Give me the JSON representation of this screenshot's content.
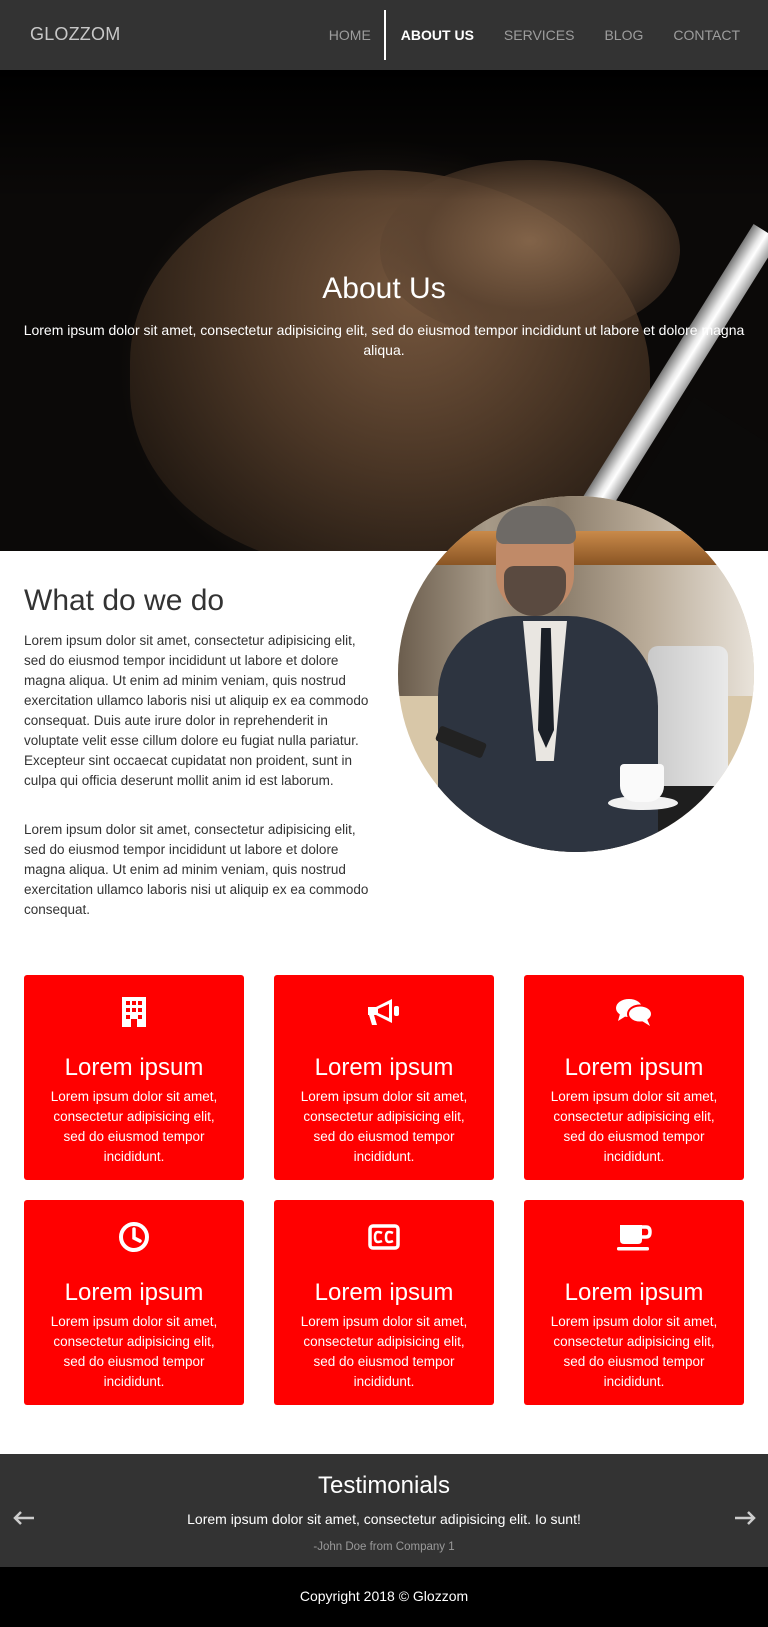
{
  "nav": {
    "brand": "GLOZZOM",
    "links": [
      {
        "label": "HOME",
        "active": false
      },
      {
        "label": "ABOUT US",
        "active": true
      },
      {
        "label": "SERVICES",
        "active": false
      },
      {
        "label": "BLOG",
        "active": false
      },
      {
        "label": "CONTACT",
        "active": false
      }
    ]
  },
  "hero": {
    "title": "About Us",
    "text": "Lorem ipsum dolor sit amet, consectetur adipisicing elit, sed do eiusmod tempor incididunt ut labore et dolore magna aliqua."
  },
  "about": {
    "title": "What do we do",
    "paragraph1": "Lorem ipsum dolor sit amet, consectetur adipisicing elit, sed do eiusmod tempor incididunt ut labore et dolore magna aliqua. Ut enim ad minim veniam, quis nostrud exercitation ullamco laboris nisi ut aliquip ex ea commodo consequat. Duis aute irure dolor in reprehenderit in voluptate velit esse cillum dolore eu fugiat nulla pariatur. Excepteur sint occaecat cupidatat non proident, sunt in culpa qui officia deserunt mollit anim id est laborum.",
    "paragraph2": "Lorem ipsum dolor sit amet, consectetur adipisicing elit, sed do eiusmod tempor incididunt ut labore et dolore magna aliqua. Ut enim ad minim veniam, quis nostrud exercitation ullamco laboris nisi ut aliquip ex ea commodo consequat."
  },
  "features": [
    {
      "icon": "building-icon",
      "title": "Lorem ipsum",
      "text": "Lorem ipsum dolor sit amet, consectetur adipisicing elit, sed do eiusmod tempor incididunt."
    },
    {
      "icon": "bullhorn-icon",
      "title": "Lorem ipsum",
      "text": "Lorem ipsum dolor sit amet, consectetur adipisicing elit, sed do eiusmod tempor incididunt."
    },
    {
      "icon": "comments-icon",
      "title": "Lorem ipsum",
      "text": "Lorem ipsum dolor sit amet, consectetur adipisicing elit, sed do eiusmod tempor incididunt."
    },
    {
      "icon": "clock-icon",
      "title": "Lorem ipsum",
      "text": "Lorem ipsum dolor sit amet, consectetur adipisicing elit, sed do eiusmod tempor incididunt."
    },
    {
      "icon": "closed-captioning-icon",
      "title": "Lorem ipsum",
      "text": "Lorem ipsum dolor sit amet, consectetur adipisicing elit, sed do eiusmod tempor incididunt."
    },
    {
      "icon": "coffee-icon",
      "title": "Lorem ipsum",
      "text": "Lorem ipsum dolor sit amet, consectetur adipisicing elit, sed do eiusmod tempor incididunt."
    }
  ],
  "testimonials": {
    "title": "Testimonials",
    "quote": "Lorem ipsum dolor sit amet, consectetur adipisicing elit. Io sunt!",
    "author": "-John Doe from Company 1",
    "prev_icon": "arrow-left-icon",
    "next_icon": "arrow-right-icon"
  },
  "footer": {
    "copyright": "Copyright 2018 © Glozzom"
  },
  "colors": {
    "nav_bg": "#333333",
    "accent": "#ff0000",
    "footer_bg": "#000000"
  }
}
